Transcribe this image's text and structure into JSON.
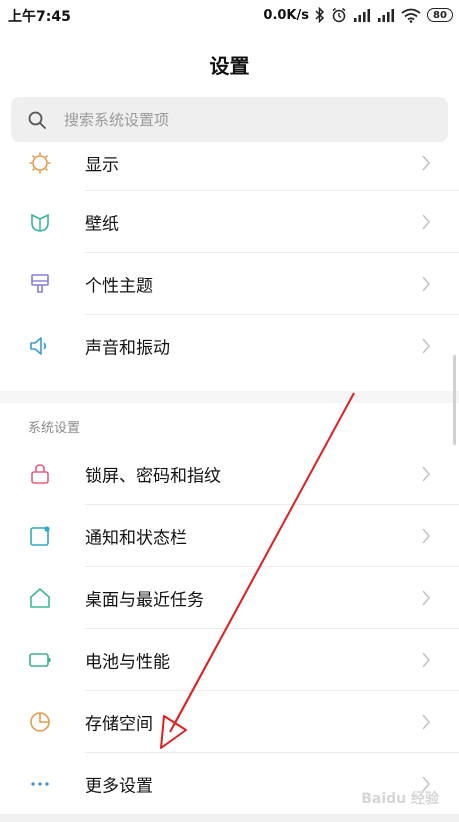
{
  "status_bar": {
    "time": "上午7:45",
    "network_speed": "0.0K/s",
    "battery": "80",
    "icons": [
      "bluetooth-icon",
      "alarm-icon",
      "signal-icon",
      "signal-icon",
      "wifi-icon",
      "battery-icon"
    ]
  },
  "header": {
    "title": "设置"
  },
  "search": {
    "placeholder": "搜索系统设置项",
    "icon": "search-icon"
  },
  "group_top": {
    "items": [
      {
        "label": "显示",
        "icon": "sun-icon",
        "color": "#e59a4e"
      },
      {
        "label": "壁纸",
        "icon": "wallpaper-icon",
        "color": "#39b39a"
      },
      {
        "label": "个性主题",
        "icon": "brush-icon",
        "color": "#8a7bd1"
      },
      {
        "label": "声音和振动",
        "icon": "speaker-icon",
        "color": "#3a9bd6"
      }
    ]
  },
  "group_system": {
    "header": "系统设置",
    "items": [
      {
        "label": "锁屏、密码和指纹",
        "icon": "lock-icon",
        "color": "#e0607a"
      },
      {
        "label": "通知和状态栏",
        "icon": "notification-icon",
        "color": "#2fa9c4"
      },
      {
        "label": "桌面与最近任务",
        "icon": "home-icon",
        "color": "#3fb895"
      },
      {
        "label": "电池与性能",
        "icon": "battery-outline-icon",
        "color": "#36b38d"
      },
      {
        "label": "存储空间",
        "icon": "pie-chart-icon",
        "color": "#e59a4e"
      },
      {
        "label": "更多设置",
        "icon": "more-icon",
        "color": "#3a8fd6"
      }
    ]
  },
  "colors": {
    "annotation_arrow": "#e02020",
    "chevron": "#c4c4c4"
  },
  "watermark": "Baidu 经验"
}
